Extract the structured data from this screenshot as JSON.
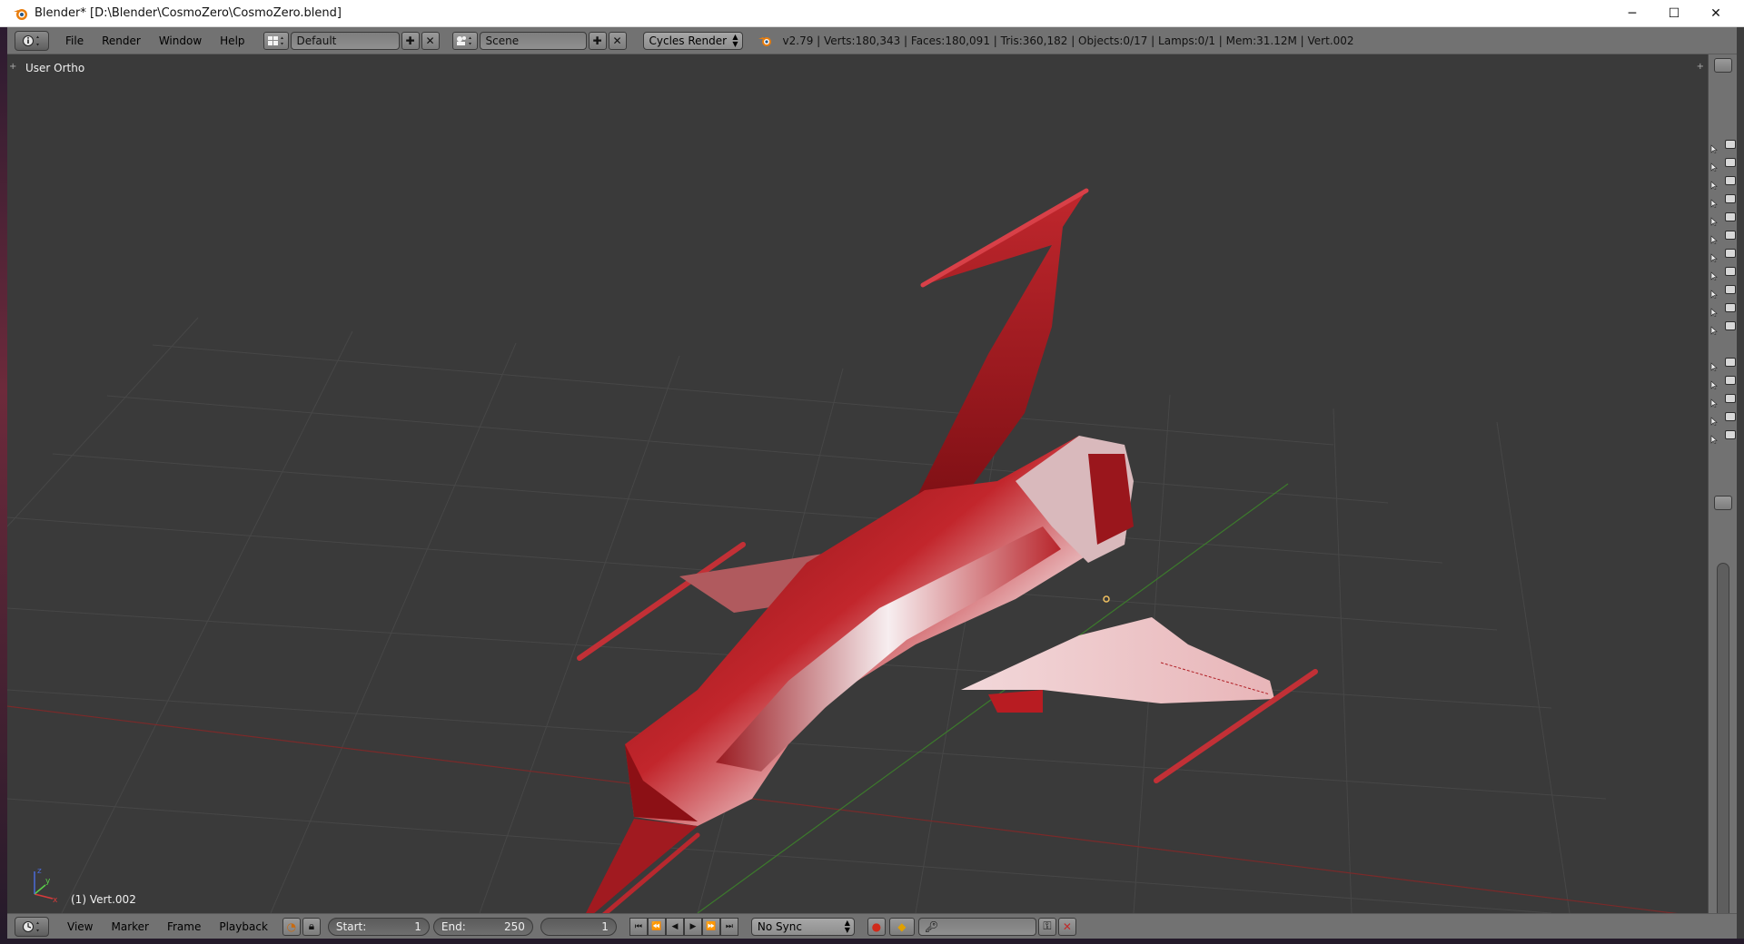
{
  "window": {
    "title": "Blender* [D:\\Blender\\CosmoZero\\CosmoZero.blend]",
    "minimize_glyph": "─",
    "maximize_glyph": "☐",
    "close_glyph": "✕"
  },
  "info_header": {
    "menus": [
      "File",
      "Render",
      "Window",
      "Help"
    ],
    "screen_layout": "Default",
    "scene": "Scene",
    "render_engine": "Cycles Render",
    "stats": "v2.79 | Verts:180,343 | Faces:180,091 | Tris:360,182 | Objects:0/17 | Lamps:0/1 | Mem:31.12M | Vert.002"
  },
  "viewport": {
    "view_label": "User Ortho",
    "object_label": "(1) Vert.002",
    "axis_labels": {
      "x": "x",
      "y": "y",
      "z": "z"
    }
  },
  "timeline": {
    "menus": [
      "View",
      "Marker",
      "Frame",
      "Playback"
    ],
    "start_label": "Start:",
    "start_value": "1",
    "end_label": "End:",
    "end_value": "250",
    "current_frame": "1",
    "sync": "No Sync"
  },
  "colors": {
    "header_bg": "#727272",
    "viewport_bg": "#3a3a3a",
    "ship_red": "#b0141a",
    "grid_line": "#4b4b4b",
    "x_axis": "#8a2a2a",
    "y_axis": "#3c7a2c"
  }
}
